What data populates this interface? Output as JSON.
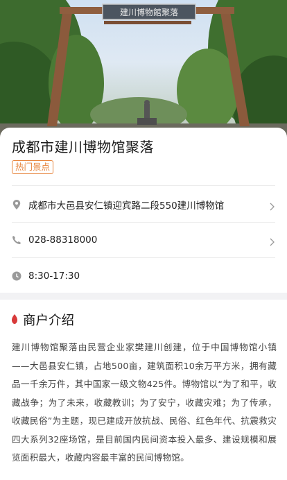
{
  "hero": {
    "gate_sign": "建川博物館聚落",
    "image_desc_icon": "museum-gate-photo"
  },
  "place": {
    "name": "成都市建川博物馆聚落",
    "tag": "热门景点"
  },
  "info_rows": [
    {
      "icon": "location-pin-icon",
      "text": "成都市大邑县安仁镇迎宾路二段550建川博物馆",
      "has_arrow": true
    },
    {
      "icon": "phone-icon",
      "text": "028-88318000",
      "has_arrow": true
    },
    {
      "icon": "clock-icon",
      "text": "8:30-17:30",
      "has_arrow": false
    }
  ],
  "intro": {
    "title": "商户介绍",
    "body": "建川博物馆聚落由民营企业家樊建川创建，位于中国博物馆小镇——大邑县安仁镇，占地500亩，建筑面积10余万平方米，拥有藏品一千余万件，其中国家一级文物425件。博物馆以“为了和平，收藏战争；为了未来，收藏教训；为了安宁，收藏灾难；为了传承，收藏民俗”为主题，现已建成开放抗战、民俗、红色年代、抗震救灾四大系列32座场馆，是目前国内民间资本投入最多、建设规模和展览面积最大，收藏内容最丰富的民间博物馆。"
  },
  "colors": {
    "accent_tag": "#e7833a",
    "intro_marker": "#d83a3a",
    "icon_gray": "#9a9a9a"
  }
}
